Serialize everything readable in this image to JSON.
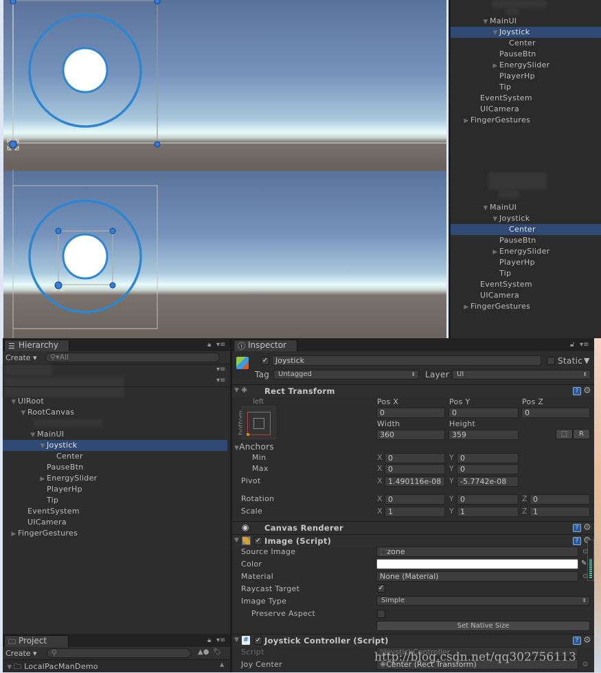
{
  "scene_views": [
    {
      "label": "Joystick selected"
    },
    {
      "label": "Center selected"
    }
  ],
  "mini_hierarchies": [
    {
      "selected": "Joystick",
      "items": [
        {
          "label": "MainUI",
          "depth": 0,
          "arrow": "expanded"
        },
        {
          "label": "Joystick",
          "depth": 1,
          "arrow": "expanded",
          "selected": true
        },
        {
          "label": "Center",
          "depth": 2,
          "arrow": "none"
        },
        {
          "label": "PauseBtn",
          "depth": 1,
          "arrow": "none"
        },
        {
          "label": "EnergySlider",
          "depth": 1,
          "arrow": "collapsed"
        },
        {
          "label": "PlayerHp",
          "depth": 1,
          "arrow": "none"
        },
        {
          "label": "Tip",
          "depth": 1,
          "arrow": "none"
        },
        {
          "label": "EventSystem",
          "depth": -1,
          "arrow": "none"
        },
        {
          "label": "UICamera",
          "depth": -1,
          "arrow": "none"
        },
        {
          "label": "FingerGestures",
          "depth": -2,
          "arrow": "collapsed"
        }
      ]
    },
    {
      "selected": "Center",
      "items": [
        {
          "label": "MainUI",
          "depth": 0,
          "arrow": "expanded"
        },
        {
          "label": "Joystick",
          "depth": 1,
          "arrow": "expanded"
        },
        {
          "label": "Center",
          "depth": 2,
          "arrow": "none",
          "selected": true
        },
        {
          "label": "PauseBtn",
          "depth": 1,
          "arrow": "none"
        },
        {
          "label": "EnergySlider",
          "depth": 1,
          "arrow": "collapsed"
        },
        {
          "label": "PlayerHp",
          "depth": 1,
          "arrow": "none"
        },
        {
          "label": "Tip",
          "depth": 1,
          "arrow": "none"
        },
        {
          "label": "EventSystem",
          "depth": -1,
          "arrow": "none"
        },
        {
          "label": "UICamera",
          "depth": -1,
          "arrow": "none"
        },
        {
          "label": "FingerGestures",
          "depth": -2,
          "arrow": "collapsed"
        }
      ]
    }
  ],
  "hierarchy": {
    "tab_label": "Hierarchy",
    "create_label": "Create",
    "search_placeholder": "All",
    "items": [
      {
        "label": "UIRoot",
        "depth": 0,
        "arrow": "expanded"
      },
      {
        "label": "RootCanvas",
        "depth": 1,
        "arrow": "expanded"
      },
      {
        "label": "MainUI",
        "depth": 2,
        "arrow": "expanded"
      },
      {
        "label": "Joystick",
        "depth": 3,
        "arrow": "expanded",
        "selected": true
      },
      {
        "label": "Center",
        "depth": 4,
        "arrow": "none"
      },
      {
        "label": "PauseBtn",
        "depth": 3,
        "arrow": "none"
      },
      {
        "label": "EnergySlider",
        "depth": 3,
        "arrow": "collapsed"
      },
      {
        "label": "PlayerHp",
        "depth": 3,
        "arrow": "none"
      },
      {
        "label": "Tip",
        "depth": 3,
        "arrow": "none"
      },
      {
        "label": "EventSystem",
        "depth": 1,
        "arrow": "none"
      },
      {
        "label": "UICamera",
        "depth": 1,
        "arrow": "none"
      },
      {
        "label": "FingerGestures",
        "depth": 0,
        "arrow": "collapsed"
      }
    ]
  },
  "project": {
    "tab_label": "Project",
    "create_label": "Create",
    "search_placeholder": "",
    "items": [
      {
        "label": "LocalPacManDemo"
      }
    ]
  },
  "inspector": {
    "tab_label": "Inspector",
    "object_active": true,
    "object_name": "Joystick",
    "static_label": "Static",
    "static_checked": false,
    "tag_label": "Tag",
    "tag_value": "Untagged",
    "layer_label": "Layer",
    "layer_value": "UI",
    "rect_transform": {
      "title": "Rect Transform",
      "anchor_h_label": "left",
      "anchor_v_label": "bottom",
      "pos_x_label": "Pos X",
      "pos_x": "0",
      "pos_y_label": "Pos Y",
      "pos_y": "0",
      "pos_z_label": "Pos Z",
      "pos_z": "0",
      "width_label": "Width",
      "width": "360",
      "height_label": "Height",
      "height": "359",
      "r_button": "R",
      "anchors_label": "Anchors",
      "min_label": "Min",
      "min_x": "0",
      "min_y": "0",
      "max_label": "Max",
      "max_x": "0",
      "max_y": "0",
      "pivot_label": "Pivot",
      "pivot_x": "1.490116e-08",
      "pivot_y": "-5.7742e-08",
      "rotation_label": "Rotation",
      "rot_x": "0",
      "rot_y": "0",
      "rot_z": "0",
      "scale_label": "Scale",
      "scale_x": "1",
      "scale_y": "1",
      "scale_z": "1",
      "x": "X",
      "y": "Y",
      "z": "Z"
    },
    "canvas_renderer": {
      "title": "Canvas Renderer"
    },
    "image": {
      "title": "Image (Script)",
      "enabled": true,
      "source_image_label": "Source Image",
      "source_image": "zone",
      "color_label": "Color",
      "color": "#ffffff",
      "material_label": "Material",
      "material": "None (Material)",
      "raycast_label": "Raycast Target",
      "raycast": true,
      "image_type_label": "Image Type",
      "image_type": "Simple",
      "preserve_label": "Preserve Aspect",
      "preserve": false,
      "native_size_button": "Set Native Size"
    },
    "joystick_controller": {
      "title": "Joystick Controller (Script)",
      "enabled": true,
      "script_label": "Script",
      "script": "JoystickController",
      "joy_center_label": "Joy Center",
      "joy_center": "Center (Rect Transform)"
    }
  },
  "watermark": "http://blog.csdn.net/qq302756113",
  "colors": {
    "selection": "#2f4a75",
    "panel": "#2d2d2d",
    "joystick_ring": "#2f86d0",
    "handle": "#2f7fe0"
  }
}
